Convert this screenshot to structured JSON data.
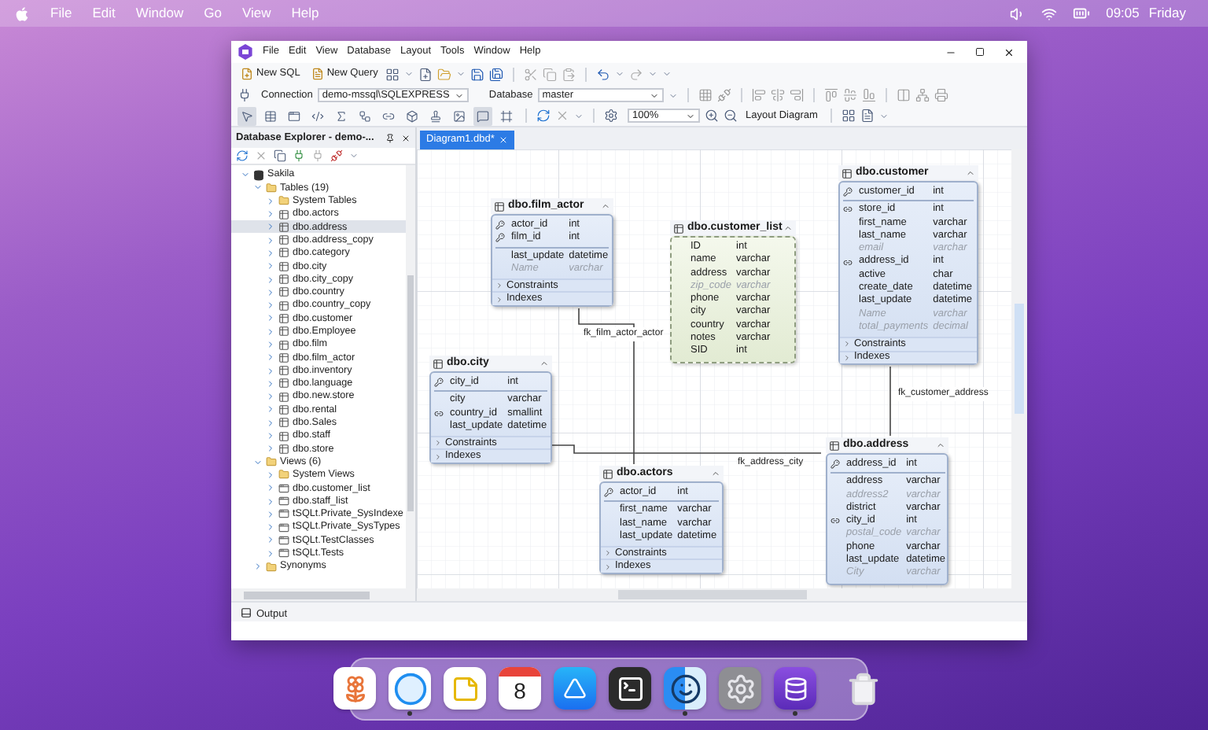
{
  "menubar": {
    "menus": [
      "File",
      "Edit",
      "Window",
      "Go",
      "View",
      "Help"
    ],
    "time": "09:05",
    "day": "Friday"
  },
  "window": {
    "menus": [
      "File",
      "Edit",
      "View",
      "Database",
      "Layout",
      "Tools",
      "Window",
      "Help"
    ],
    "toolbar": {
      "new_sql": "New SQL",
      "new_query": "New Query",
      "connection_label": "Connection",
      "connection": "demo-mssql\\SQLEXPRESS",
      "database_label": "Database",
      "database": "master",
      "zoom": "100%",
      "layout": "Layout Diagram"
    },
    "diagram_tools": [
      {
        "kind": "pointer",
        "selected": true
      },
      {
        "kind": "table",
        "selected": false
      },
      {
        "kind": "view",
        "selected": false
      },
      {
        "kind": "procedure",
        "selected": false
      },
      {
        "kind": "function",
        "selected": false
      },
      {
        "kind": "relation",
        "selected": false
      },
      {
        "kind": "link",
        "selected": false
      },
      {
        "kind": "container",
        "selected": false
      },
      {
        "kind": "stamp",
        "selected": false
      },
      {
        "kind": "image",
        "selected": false
      },
      {
        "kind": "note",
        "selected": true
      },
      {
        "kind": "frame",
        "selected": false
      }
    ]
  },
  "explorer": {
    "title": "Database Explorer - demo-...",
    "tree": [
      {
        "label": "Sakila",
        "kind": "database",
        "expanded": true,
        "selected": false,
        "children": [
          {
            "label": "Tables (19)",
            "kind": "folder",
            "expanded": true,
            "selected": false,
            "children": [
              {
                "label": "System Tables",
                "kind": "folder",
                "expanded": false,
                "selected": false
              },
              {
                "label": "dbo.actors",
                "kind": "table",
                "expanded": false,
                "selected": false
              },
              {
                "label": "dbo.address",
                "kind": "table",
                "expanded": false,
                "selected": true
              },
              {
                "label": "dbo.address_copy",
                "kind": "table",
                "expanded": false,
                "selected": false
              },
              {
                "label": "dbo.category",
                "kind": "table",
                "expanded": false,
                "selected": false
              },
              {
                "label": "dbo.city",
                "kind": "table",
                "expanded": false,
                "selected": false
              },
              {
                "label": "dbo.city_copy",
                "kind": "table",
                "expanded": false,
                "selected": false
              },
              {
                "label": "dbo.country",
                "kind": "table",
                "expanded": false,
                "selected": false
              },
              {
                "label": "dbo.country_copy",
                "kind": "table",
                "expanded": false,
                "selected": false
              },
              {
                "label": "dbo.customer",
                "kind": "table",
                "expanded": false,
                "selected": false
              },
              {
                "label": "dbo.Employee",
                "kind": "table",
                "expanded": false,
                "selected": false
              },
              {
                "label": "dbo.film",
                "kind": "table",
                "expanded": false,
                "selected": false
              },
              {
                "label": "dbo.film_actor",
                "kind": "table",
                "expanded": false,
                "selected": false
              },
              {
                "label": "dbo.inventory",
                "kind": "table",
                "expanded": false,
                "selected": false
              },
              {
                "label": "dbo.language",
                "kind": "table",
                "expanded": false,
                "selected": false
              },
              {
                "label": "dbo.new.store",
                "kind": "table",
                "expanded": false,
                "selected": false
              },
              {
                "label": "dbo.rental",
                "kind": "table",
                "expanded": false,
                "selected": false
              },
              {
                "label": "dbo.Sales",
                "kind": "table",
                "expanded": false,
                "selected": false
              },
              {
                "label": "dbo.staff",
                "kind": "table",
                "expanded": false,
                "selected": false
              },
              {
                "label": "dbo.store",
                "kind": "table",
                "expanded": false,
                "selected": false
              }
            ]
          },
          {
            "label": "Views (6)",
            "kind": "folder",
            "expanded": true,
            "selected": false,
            "children": [
              {
                "label": "System Views",
                "kind": "folder",
                "expanded": false,
                "selected": false
              },
              {
                "label": "dbo.customer_list",
                "kind": "view",
                "expanded": false,
                "selected": false
              },
              {
                "label": "dbo.staff_list",
                "kind": "view",
                "expanded": false,
                "selected": false
              },
              {
                "label": "tSQLt.Private_SysIndexe",
                "kind": "view",
                "expanded": false,
                "selected": false
              },
              {
                "label": "tSQLt.Private_SysTypes",
                "kind": "view",
                "expanded": false,
                "selected": false
              },
              {
                "label": "tSQLt.TestClasses",
                "kind": "view",
                "expanded": false,
                "selected": false
              },
              {
                "label": "tSQLt.Tests",
                "kind": "view",
                "expanded": false,
                "selected": false
              }
            ]
          },
          {
            "label": "Synonyms",
            "kind": "folder",
            "expanded": false,
            "selected": false
          }
        ]
      }
    ]
  },
  "diagram": {
    "tab": {
      "label": "Diagram1.dbd*",
      "selected": true
    },
    "tables": [
      {
        "name": "dbo.customer",
        "kind": "table",
        "columns": [
          {
            "name": "customer_id",
            "type": "int",
            "kind": "pk"
          },
          {
            "name": "store_id",
            "type": "int",
            "kind": "fk"
          },
          {
            "name": "first_name",
            "type": "varchar",
            "kind": "plain"
          },
          {
            "name": "last_name",
            "type": "varchar",
            "kind": "plain"
          },
          {
            "name": "email",
            "type": "varchar",
            "kind": "virtual"
          },
          {
            "name": "address_id",
            "type": "int",
            "kind": "fk"
          },
          {
            "name": "active",
            "type": "char",
            "kind": "plain"
          },
          {
            "name": "create_date",
            "type": "datetime",
            "kind": "plain"
          },
          {
            "name": "last_update",
            "type": "datetime",
            "kind": "plain"
          },
          {
            "name": "Name",
            "type": "varchar",
            "kind": "virtual"
          },
          {
            "name": "total_payments",
            "type": "decimal",
            "kind": "virtual"
          }
        ],
        "sections": [
          "Constraints",
          "Indexes"
        ]
      },
      {
        "name": "dbo.film_actor",
        "kind": "table",
        "columns": [
          {
            "name": "actor_id",
            "type": "int",
            "kind": "pk"
          },
          {
            "name": "film_id",
            "type": "int",
            "kind": "pk"
          },
          {
            "name": "last_update",
            "type": "datetime",
            "kind": "plain"
          },
          {
            "name": "Name",
            "type": "varchar",
            "kind": "virtual"
          }
        ],
        "sections": [
          "Constraints",
          "Indexes"
        ]
      },
      {
        "name": "dbo.customer_list",
        "kind": "view",
        "columns": [
          {
            "name": "ID",
            "type": "int",
            "kind": "plain"
          },
          {
            "name": "name",
            "type": "varchar",
            "kind": "plain"
          },
          {
            "name": "address",
            "type": "varchar",
            "kind": "plain"
          },
          {
            "name": "zip_code",
            "type": "varchar",
            "kind": "virtual"
          },
          {
            "name": "phone",
            "type": "varchar",
            "kind": "plain"
          },
          {
            "name": "city",
            "type": "varchar",
            "kind": "plain"
          },
          {
            "name": "country",
            "type": "varchar",
            "kind": "plain"
          },
          {
            "name": "notes",
            "type": "varchar",
            "kind": "plain"
          },
          {
            "name": "SID",
            "type": "int",
            "kind": "plain"
          }
        ]
      },
      {
        "name": "dbo.city",
        "kind": "table",
        "columns": [
          {
            "name": "city_id",
            "type": "int",
            "kind": "pk"
          },
          {
            "name": "city",
            "type": "varchar",
            "kind": "plain"
          },
          {
            "name": "country_id",
            "type": "smallint",
            "kind": "fk"
          },
          {
            "name": "last_update",
            "type": "datetime",
            "kind": "plain"
          }
        ],
        "sections": [
          "Constraints",
          "Indexes"
        ]
      },
      {
        "name": "dbo.address",
        "kind": "table",
        "columns": [
          {
            "name": "address_id",
            "type": "int",
            "kind": "pk"
          },
          {
            "name": "address",
            "type": "varchar",
            "kind": "plain"
          },
          {
            "name": "address2",
            "type": "varchar",
            "kind": "virtual"
          },
          {
            "name": "district",
            "type": "varchar",
            "kind": "plain"
          },
          {
            "name": "city_id",
            "type": "int",
            "kind": "fk"
          },
          {
            "name": "postal_code",
            "type": "varchar",
            "kind": "virtual"
          },
          {
            "name": "phone",
            "type": "varchar",
            "kind": "plain"
          },
          {
            "name": "last_update",
            "type": "datetime",
            "kind": "plain"
          },
          {
            "name": "City",
            "type": "varchar",
            "kind": "virtual"
          }
        ]
      },
      {
        "name": "dbo.actors",
        "kind": "table",
        "columns": [
          {
            "name": "actor_id",
            "type": "int",
            "kind": "pk"
          },
          {
            "name": "first_name",
            "type": "varchar",
            "kind": "plain"
          },
          {
            "name": "last_name",
            "type": "varchar",
            "kind": "plain"
          },
          {
            "name": "last_update",
            "type": "datetime",
            "kind": "plain"
          }
        ],
        "sections": [
          "Constraints",
          "Indexes"
        ]
      }
    ],
    "relations": [
      {
        "label": "fk_film_actor_actor"
      },
      {
        "label": "fk_address_city"
      },
      {
        "label": "fk_customer_address"
      }
    ]
  },
  "output": {
    "label": "Output"
  },
  "dock": [
    {
      "kind": "photos",
      "running": false
    },
    {
      "kind": "safari",
      "running": true
    },
    {
      "kind": "notes",
      "running": false
    },
    {
      "kind": "calendar",
      "label": "8",
      "running": false
    },
    {
      "kind": "appstore",
      "running": false
    },
    {
      "kind": "terminal",
      "running": false
    },
    {
      "kind": "finder",
      "running": true
    },
    {
      "kind": "settings",
      "running": false
    },
    {
      "kind": "dbforge",
      "running": true
    },
    {
      "kind": "trash",
      "running": false
    }
  ]
}
